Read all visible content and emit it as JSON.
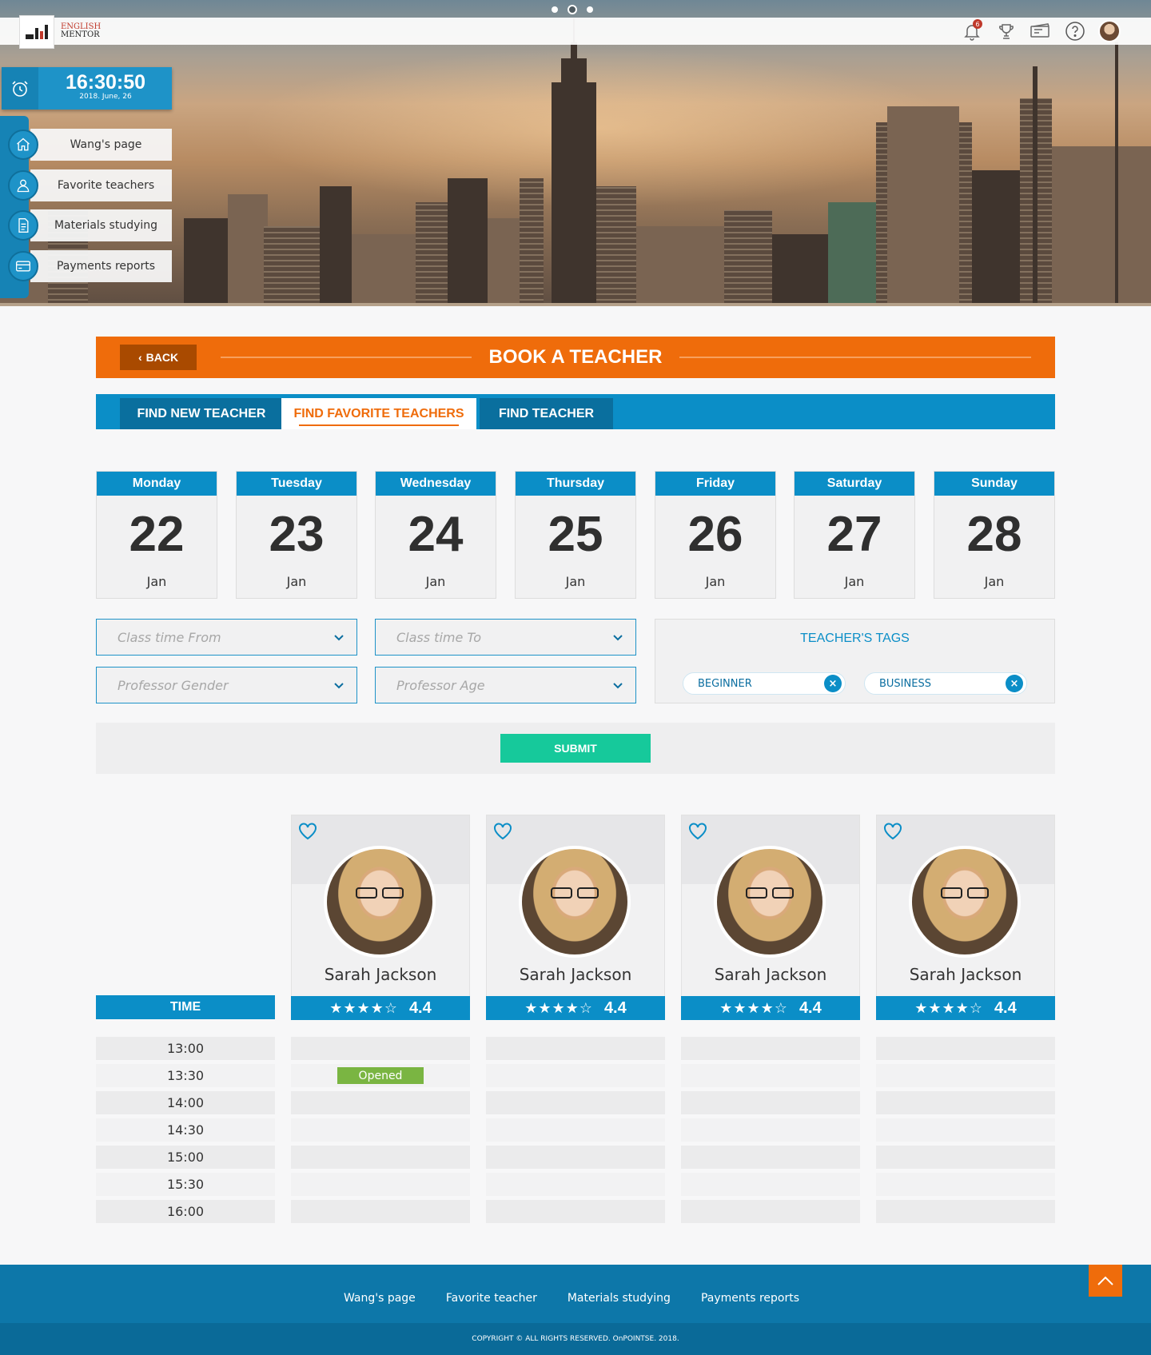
{
  "brand": {
    "logo_line1": "ENGLISH",
    "logo_line2": "MENTOR",
    "accent": "#ef6c0b",
    "primary": "#0b8ec7",
    "success": "#16c99b"
  },
  "header": {
    "notification_count": "6",
    "icons": [
      "bell-icon",
      "trophy-icon",
      "ticket-icon",
      "help-icon",
      "user-avatar"
    ]
  },
  "clock": {
    "time": "16:30:50",
    "date": "2018. June, 26"
  },
  "sidebar": {
    "items": [
      {
        "label": "Wang's page",
        "icon": "home-icon"
      },
      {
        "label": "Favorite teachers",
        "icon": "user-icon"
      },
      {
        "label": "Materials studying",
        "icon": "document-icon"
      },
      {
        "label": "Payments reports",
        "icon": "credit-card-icon"
      }
    ]
  },
  "book": {
    "back_label": "BACK",
    "title": "BOOK A TEACHER"
  },
  "tabs": [
    {
      "label": "FIND NEW TEACHER",
      "active": false
    },
    {
      "label": "FIND FAVORITE TEACHERS",
      "active": true
    },
    {
      "label": "FIND TEACHER",
      "active": false
    }
  ],
  "days": [
    {
      "name": "Monday",
      "num": "22",
      "month": "Jan"
    },
    {
      "name": "Tuesday",
      "num": "23",
      "month": "Jan"
    },
    {
      "name": "Wednesday",
      "num": "24",
      "month": "Jan"
    },
    {
      "name": "Thursday",
      "num": "25",
      "month": "Jan"
    },
    {
      "name": "Friday",
      "num": "26",
      "month": "Jan"
    },
    {
      "name": "Saturday",
      "num": "27",
      "month": "Jan"
    },
    {
      "name": "Sunday",
      "num": "28",
      "month": "Jan"
    }
  ],
  "filters": {
    "class_from": "Class time From",
    "class_to": "Class time To",
    "gender": "Professor Gender",
    "age": "Professor Age"
  },
  "tags": {
    "title": "TEACHER'S TAGS",
    "items": [
      "BEGINNER",
      "BUSINESS"
    ]
  },
  "submit_label": "SUBMIT",
  "teachers": [
    {
      "name": "Sarah Jackson",
      "rating": "4.4",
      "stars": 4.5
    },
    {
      "name": "Sarah Jackson",
      "rating": "4.4",
      "stars": 4.5
    },
    {
      "name": "Sarah Jackson",
      "rating": "4.4",
      "stars": 4.5
    },
    {
      "name": "Sarah Jackson",
      "rating": "4.4",
      "stars": 4.5
    }
  ],
  "schedule": {
    "time_header": "TIME",
    "times": [
      "13:00",
      "13:30",
      "14:00",
      "14:30",
      "15:00",
      "15:30",
      "16:00"
    ],
    "opened_label": "Opened"
  },
  "footer": {
    "links": [
      "Wang's page",
      "Favorite teacher",
      "Materials studying",
      "Payments reports"
    ],
    "copyright": "COPYRIGHT © ALL RIGHTS RESERVED. OnPOINTSE. 2018."
  }
}
